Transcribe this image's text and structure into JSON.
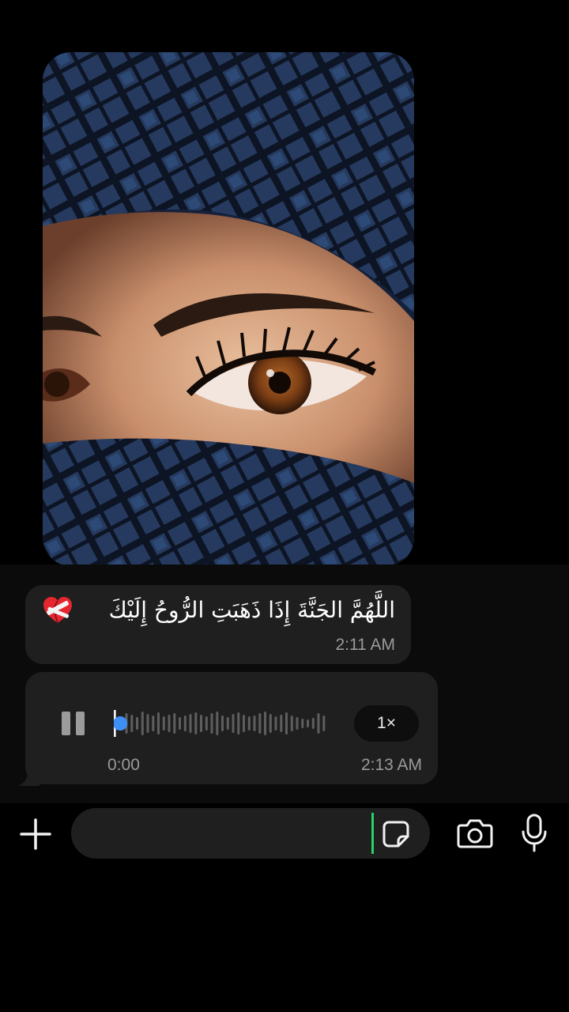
{
  "photo_message": {
    "icon": "portrait-photo"
  },
  "messages": [
    {
      "text": "اللَّهُمَّ الجَنَّةَ إِذَا ذَهَبَتِ الرُّوحُ إِلَيْكَ",
      "emoji": "mending-heart-icon",
      "time": "2:11 AM"
    }
  ],
  "voice_message": {
    "state": "playing",
    "elapsed": "0:00",
    "speed": "1×",
    "time": "2:13 AM",
    "progress": 0.03
  },
  "composer": {
    "placeholder": "",
    "value": ""
  },
  "colors": {
    "accent": "#25d366",
    "playhead": "#3d8ef5",
    "bubble": "#1f1f1f",
    "background": "#000000"
  }
}
